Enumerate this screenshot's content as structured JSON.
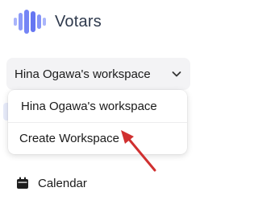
{
  "brand": {
    "name": "Votars",
    "accent_color": "#6b7cf5"
  },
  "workspace_switcher": {
    "selected": "Hina Ogawa's workspace",
    "menu_items": [
      "Hina Ogawa's workspace",
      "Create Workspace"
    ]
  },
  "nav": {
    "calendar_label": "Calendar"
  },
  "annotation": {
    "arrow_color": "#d03030"
  },
  "icons": [
    "logo-waveform-icon",
    "chevron-down-icon",
    "calendar-icon",
    "annotation-arrow-icon"
  ]
}
